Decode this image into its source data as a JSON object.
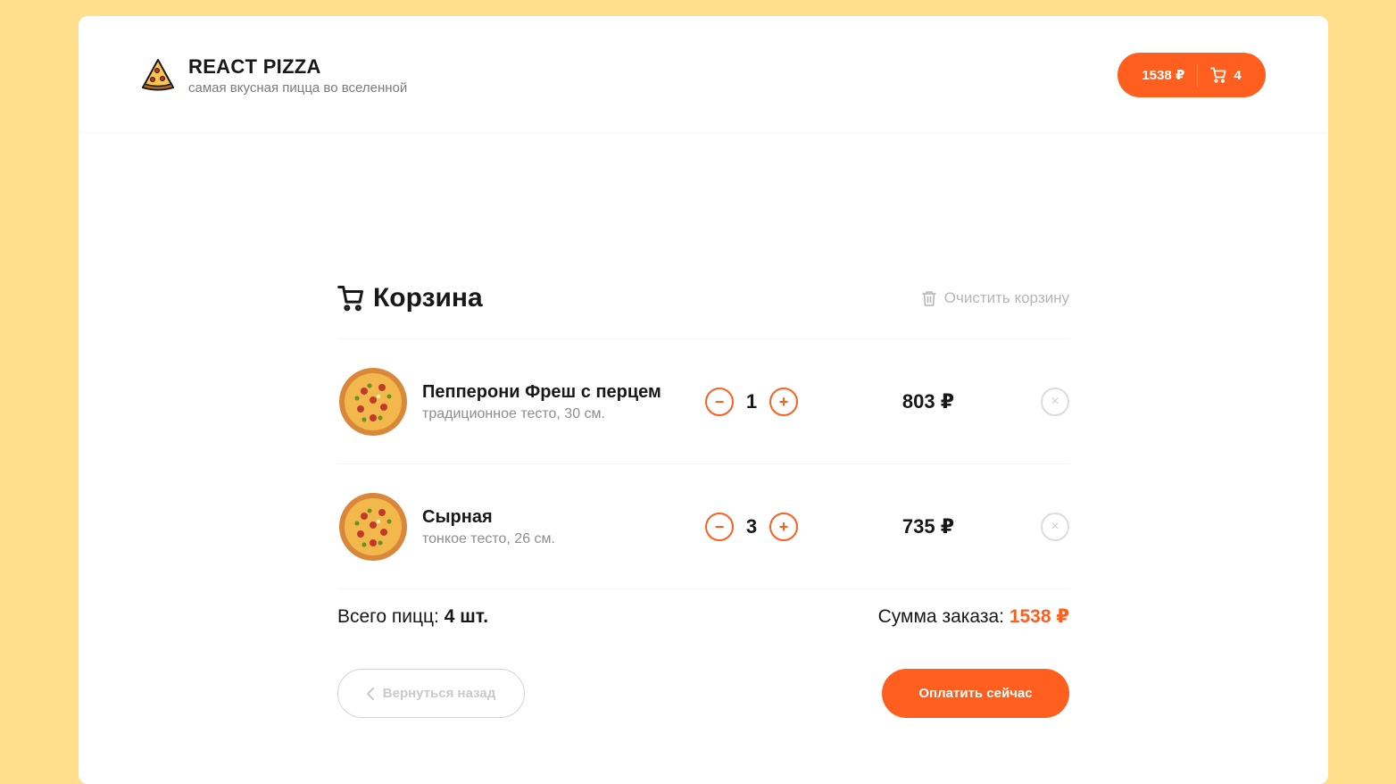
{
  "header": {
    "title": "REACT PIZZA",
    "subtitle": "самая вкусная пицца во вселенной",
    "cart_total": "1538 ₽",
    "cart_count": "4"
  },
  "cart": {
    "title": "Корзина",
    "clear_label": "Очистить корзину",
    "items": [
      {
        "name": "Пепперони Фреш с перцем",
        "desc": "традиционное тесто, 30 см.",
        "count": "1",
        "price": "803 ₽",
        "minus": "−",
        "plus": "+",
        "remove": "×"
      },
      {
        "name": "Сырная",
        "desc": "тонкое тесто, 26 см.",
        "count": "3",
        "price": "735 ₽",
        "minus": "−",
        "plus": "+",
        "remove": "×"
      }
    ],
    "total_label": "Всего пицц: ",
    "total_value": "4 шт.",
    "sum_label": "Сумма заказа: ",
    "sum_value": "1538 ₽",
    "back_label": "Вернуться назад",
    "pay_label": "Оплатить сейчас"
  },
  "colors": {
    "accent": "#fe5f1e",
    "background": "#ffdf8c"
  }
}
